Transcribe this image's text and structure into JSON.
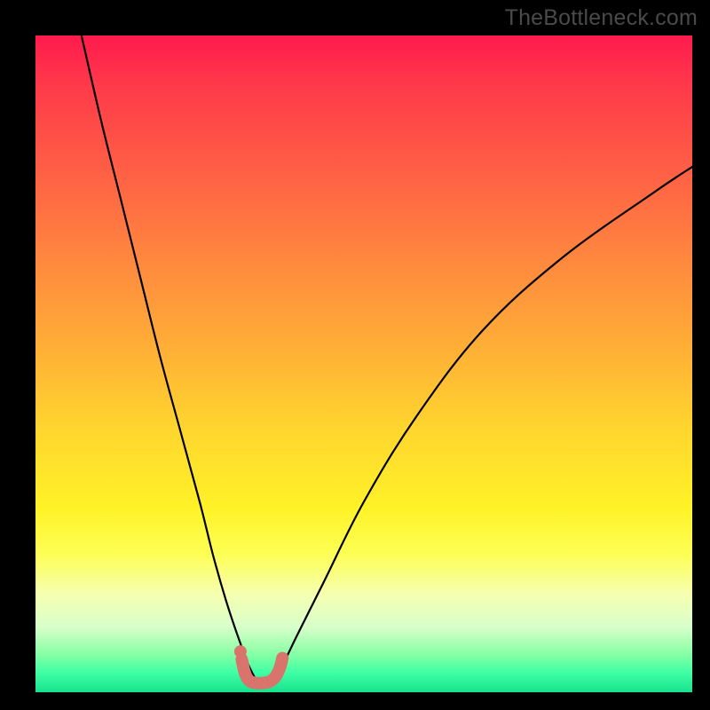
{
  "watermark": "TheBottleneck.com",
  "chart_data": {
    "type": "line",
    "title": "",
    "xlabel": "",
    "ylabel": "",
    "xlim": [
      0,
      100
    ],
    "ylim": [
      0,
      100
    ],
    "grid": false,
    "series": [
      {
        "name": "bottleneck-curve",
        "x": [
          7,
          10,
          13,
          16,
          19,
          22,
          25,
          27,
          29,
          31,
          32.5,
          34,
          35.5,
          37,
          40,
          44,
          50,
          58,
          68,
          80,
          94,
          100
        ],
        "y": [
          100,
          87,
          75,
          63,
          51,
          40,
          29,
          21,
          14,
          8,
          4,
          1.5,
          1.5,
          3,
          9,
          17,
          29,
          42,
          55,
          66,
          76,
          80
        ]
      },
      {
        "name": "optimal-range-marker",
        "x": [
          31.4,
          31.8,
          32.2,
          32.8,
          33.6,
          34.6,
          35.6,
          36.4,
          36.9,
          37.3,
          37.6
        ],
        "y": [
          5.0,
          3.2,
          2.2,
          1.6,
          1.4,
          1.4,
          1.6,
          2.2,
          3.0,
          4.0,
          5.2
        ]
      },
      {
        "name": "optimal-start-dot",
        "x": [
          31.2
        ],
        "y": [
          6.2
        ]
      }
    ],
    "colors": {
      "curve": "#000000",
      "marker": "#d8746c",
      "dot": "#d8746c"
    }
  }
}
